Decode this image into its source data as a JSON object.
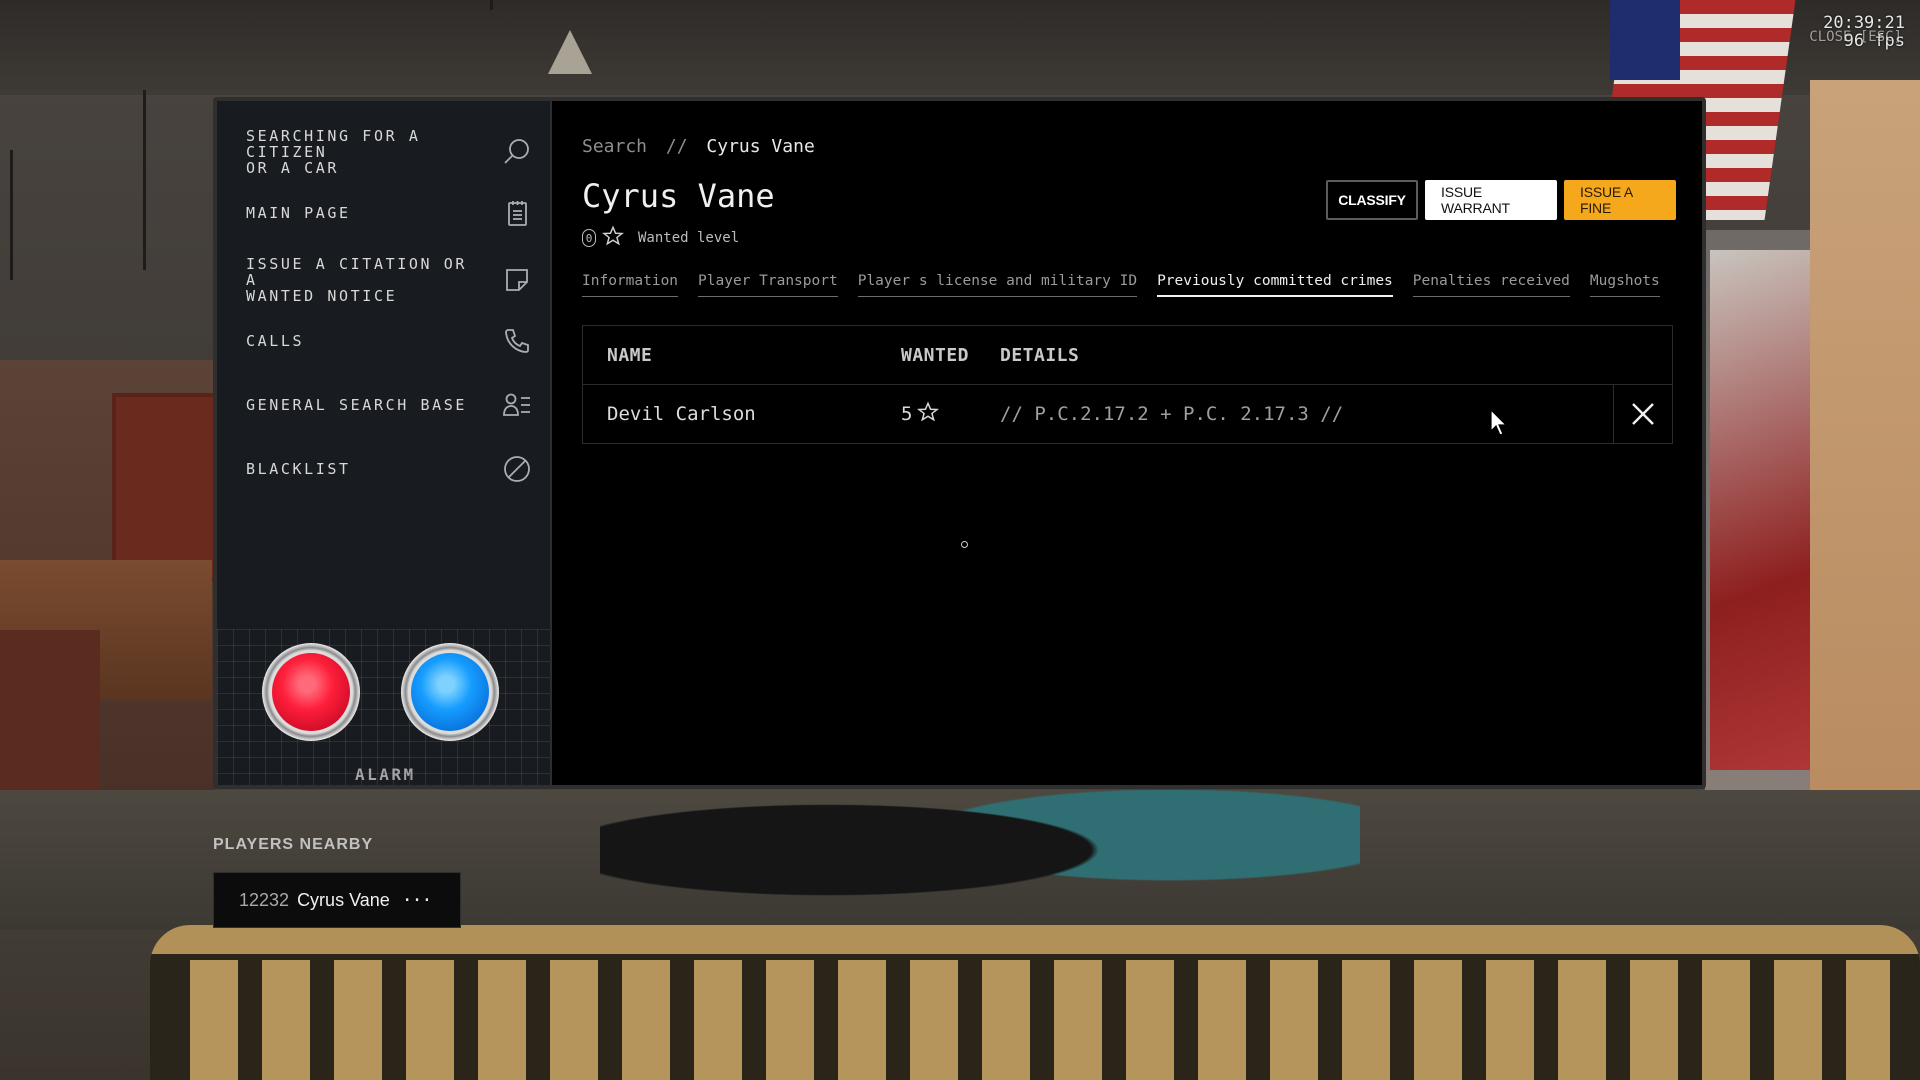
{
  "hud": {
    "time": "20:39:21",
    "fps": "96 fps",
    "close_hint": "CLOSE [ESC]"
  },
  "sidebar": {
    "items": [
      {
        "label": "SEARCHING FOR A\nCITIZEN\nOR A CAR",
        "icon": "search-icon"
      },
      {
        "label": "MAIN PAGE",
        "icon": "clipboard-icon"
      },
      {
        "label": "ISSUE A CITATION OR A\nWANTED NOTICE",
        "icon": "note-icon"
      },
      {
        "label": "CALLS",
        "icon": "phone-icon"
      },
      {
        "label": "GENERAL SEARCH BASE",
        "icon": "user-list-icon"
      },
      {
        "label": "BLACKLIST",
        "icon": "blocked-icon"
      }
    ],
    "alarm_label": "ALARM",
    "alarm_colors": {
      "red": "#ff1f3b",
      "blue": "#169dff"
    }
  },
  "header": {
    "breadcrumb_root": "Search",
    "breadcrumb_sep": "//",
    "breadcrumb_current": "Cyrus Vane",
    "name": "Cyrus Vane",
    "wanted_count": "0",
    "wanted_label": "Wanted level"
  },
  "actions": {
    "classify": "CLASSIFY",
    "issue_warrant": "ISSUE WARRANT",
    "issue_fine": "ISSUE A FINE",
    "accent_color": "#f6a81c"
  },
  "tabs": [
    {
      "label": "Information",
      "active": false
    },
    {
      "label": "Player Transport",
      "active": false
    },
    {
      "label": "Player s license and military ID",
      "active": false
    },
    {
      "label": "Previously committed crimes",
      "active": true
    },
    {
      "label": "Penalties received",
      "active": false
    },
    {
      "label": "Mugshots",
      "active": false
    }
  ],
  "table": {
    "headers": {
      "name": "NAME",
      "wanted": "WANTED",
      "details": "DETAILS"
    },
    "rows": [
      {
        "name": "Devil Carlson",
        "wanted": "5",
        "details": "// P.C.2.17.2 + P.C. 2.17.3 //"
      }
    ]
  },
  "nearby": {
    "title": "PLAYERS NEARBY",
    "players": [
      {
        "id": "12232",
        "name": "Cyrus Vane",
        "more": "···"
      }
    ]
  }
}
